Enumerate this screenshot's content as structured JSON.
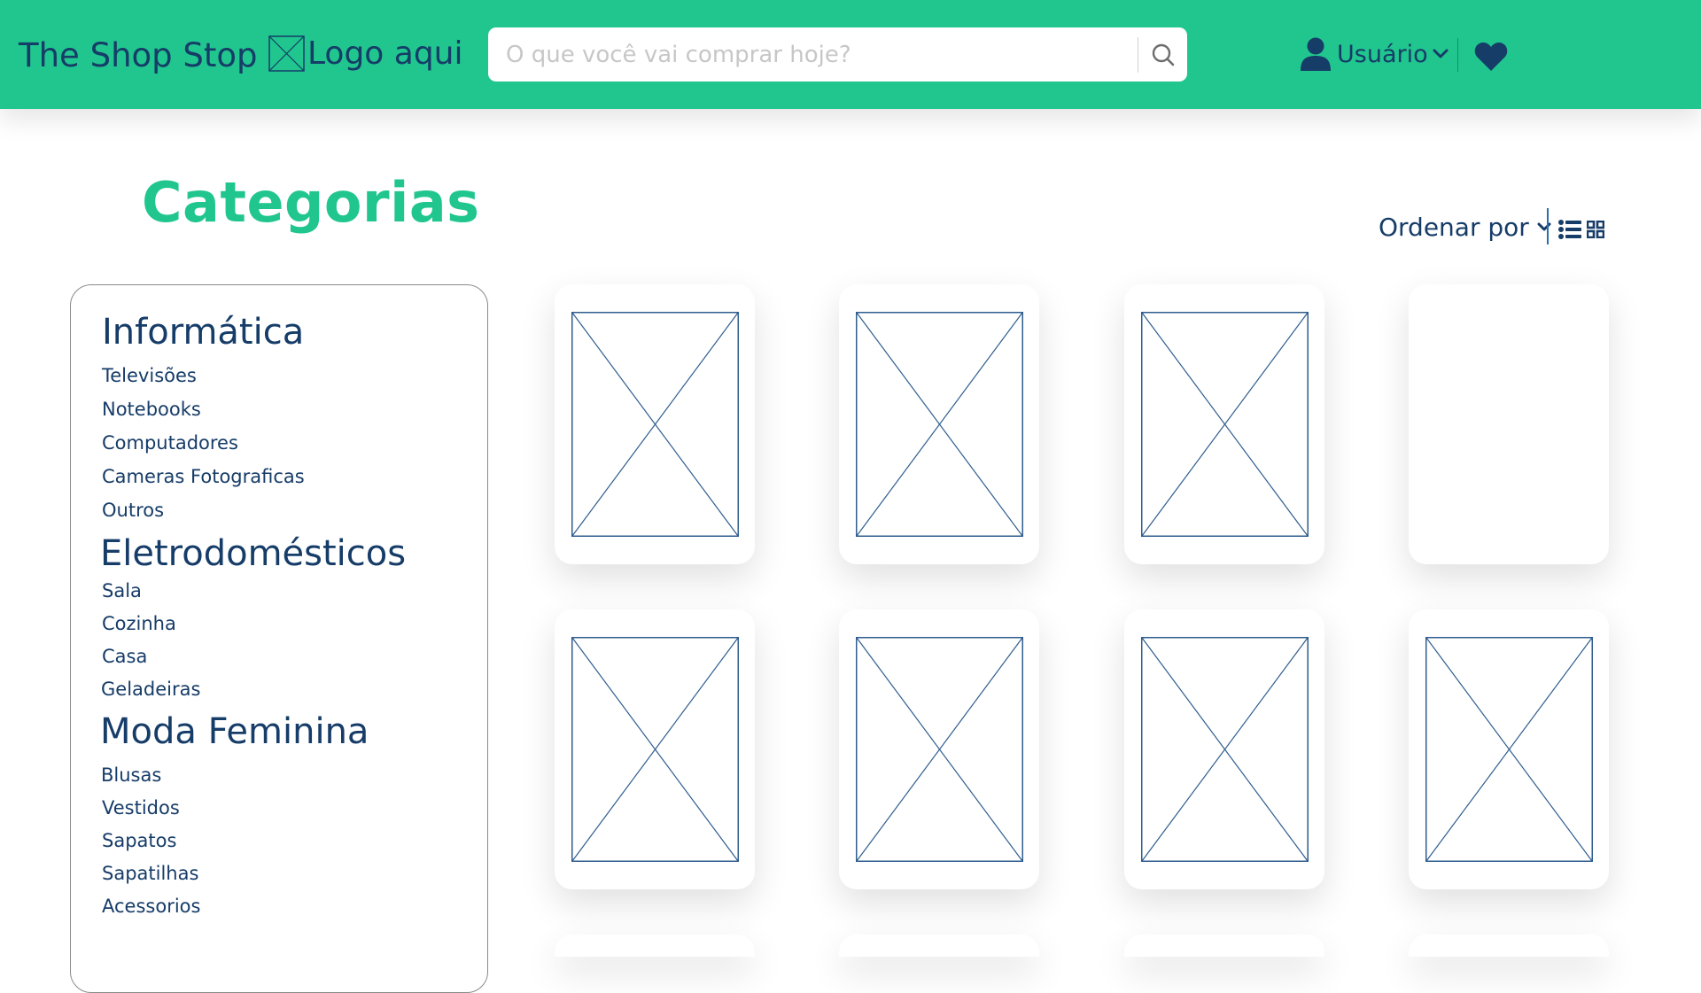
{
  "header": {
    "brand": "The Shop Stop",
    "logo_text": "Logo aqui",
    "search_placeholder": "O que você vai comprar hoje?",
    "user_label": "Usuário",
    "background_color": "#20c68e"
  },
  "main": {
    "title": "Categorias",
    "sort_label": "Ordenar por"
  },
  "sidebar": {
    "groups": [
      {
        "title": "Informática",
        "items": [
          "Televisões",
          "Notebooks",
          "Computadores",
          "Cameras Fotograficas",
          "Outros"
        ]
      },
      {
        "title": "Eletrodomésticos",
        "items": [
          "Sala",
          "Cozinha",
          "Casa",
          "Geladeiras"
        ]
      },
      {
        "title": "Moda Feminina",
        "items": [
          "Blusas",
          "Vestidos",
          "Sapatos",
          "Sapatilhas",
          "Acessorios"
        ]
      }
    ]
  },
  "icons": [
    "logo-placeholder-icon",
    "search-icon",
    "user-icon",
    "chevron-down-icon",
    "heart-icon",
    "list-view-icon",
    "grid-view-icon",
    "image-placeholder-icon"
  ],
  "colors": {
    "accent": "#20c68e",
    "text_primary": "#163c68"
  }
}
